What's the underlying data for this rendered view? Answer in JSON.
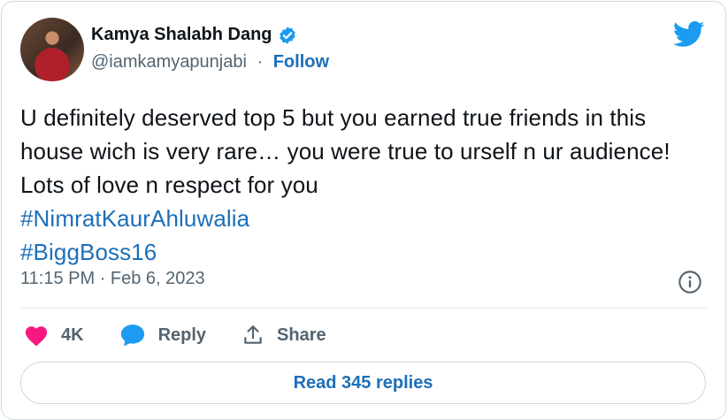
{
  "author": {
    "display_name": "Kamya Shalabh Dang",
    "handle": "@iamkamyapunjabi",
    "separator": " · ",
    "follow_label": "Follow"
  },
  "tweet": {
    "text": "U definitely deserved top 5 but you earned true friends in this house wich is very rare… you were true to urself n ur audience! Lots of love n respect for you",
    "hashtags": [
      "#NimratKaurAhluwalia",
      "#BiggBoss16"
    ],
    "timestamp": "11:15 PM · Feb 6, 2023"
  },
  "actions": {
    "likes_count": "4K",
    "reply_label": "Reply",
    "share_label": "Share"
  },
  "footer": {
    "read_replies_label": "Read 345 replies"
  },
  "colors": {
    "accent": "#1d6fb8",
    "like": "#f91880",
    "twitter_blue": "#1d9bf0"
  },
  "icons": [
    "verified-badge-icon",
    "twitter-bird-icon",
    "info-icon",
    "heart-icon",
    "reply-bubble-icon",
    "share-icon"
  ]
}
